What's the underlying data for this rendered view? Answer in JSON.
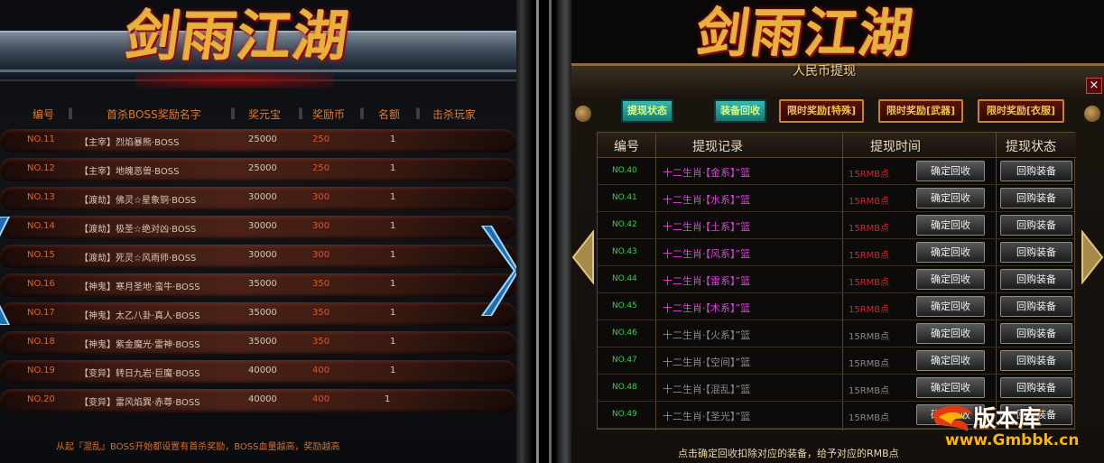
{
  "left_panel": {
    "logo_text": "剑雨江湖",
    "columns": [
      "编号",
      "首杀BOSS奖励名字",
      "奖元宝",
      "奖励币",
      "名额",
      "击杀玩家"
    ],
    "rows": [
      {
        "no": "NO.11",
        "name": "【主宰】烈焰暴熊·BOSS",
        "yuanbao": "25000",
        "coin": "250",
        "quota": "1"
      },
      {
        "no": "NO.12",
        "name": "【主宰】地魄恶兽·BOSS",
        "yuanbao": "25000",
        "coin": "250",
        "quota": "1"
      },
      {
        "no": "NO.13",
        "name": "【渡劫】佛灵☆星象铜·BOSS",
        "yuanbao": "30000",
        "coin": "300",
        "quota": "1"
      },
      {
        "no": "NO.14",
        "name": "【渡劫】极圣☆绝对凶·BOSS",
        "yuanbao": "30000",
        "coin": "300",
        "quota": "1"
      },
      {
        "no": "NO.15",
        "name": "【渡劫】死灵☆风雨师·BOSS",
        "yuanbao": "30000",
        "coin": "300",
        "quota": "1"
      },
      {
        "no": "NO.16",
        "name": "【神鬼】寒月圣地·蛮牛·BOSS",
        "yuanbao": "35000",
        "coin": "350",
        "quota": "1"
      },
      {
        "no": "NO.17",
        "name": "【神鬼】太乙八卦·真人·BOSS",
        "yuanbao": "35000",
        "coin": "350",
        "quota": "1"
      },
      {
        "no": "NO.18",
        "name": "【神鬼】紫金魔光·雷神·BOSS",
        "yuanbao": "35000",
        "coin": "350",
        "quota": "1"
      },
      {
        "no": "NO.19",
        "name": "【变异】转日九岩·巨魔·BOSS",
        "yuanbao": "40000",
        "coin": "400",
        "quota": "1"
      },
      {
        "no": "NO.20",
        "name": "【变异】雷风焰巽·赤尊·BOSS",
        "yuanbao": "40000",
        "coin": "400",
        "quota": "1"
      }
    ],
    "footer": "从起『混乱』BOSS开始都设置有首杀奖励，BOSS血量越高，奖励越高"
  },
  "right_panel": {
    "logo_text": "剑雨江湖",
    "subtitle": "人民币提现",
    "close_label": "×",
    "tabs": [
      "提现状态",
      "装备回收",
      "限时奖励[特殊]",
      "限时奖励[武器]",
      "限时奖励[衣服]"
    ],
    "columns": [
      "编号",
      "提现记录",
      "提现时间",
      "提现状态"
    ],
    "rows": [
      {
        "no": "NO.40",
        "record": "十二生肖·【金系】”篮",
        "time": "15RMB点",
        "active": true
      },
      {
        "no": "NO.41",
        "record": "十二生肖·【水系】”篮",
        "time": "15RMB点",
        "active": true
      },
      {
        "no": "NO.42",
        "record": "十二生肖·【土系】”篮",
        "time": "15RMB点",
        "active": true
      },
      {
        "no": "NO.43",
        "record": "十二生肖·【风系】”篮",
        "time": "15RMB点",
        "active": true
      },
      {
        "no": "NO.44",
        "record": "十二生肖·【雷系】”篮",
        "time": "15RMB点",
        "active": true
      },
      {
        "no": "NO.45",
        "record": "十二生肖·【木系】”篮",
        "time": "15RMB点",
        "active": true
      },
      {
        "no": "NO.46",
        "record": "十二生肖·【火系】”篮",
        "time": "15RMB点",
        "active": false
      },
      {
        "no": "NO.47",
        "record": "十二生肖·【空间】”篮",
        "time": "15RMB点",
        "active": false
      },
      {
        "no": "NO.48",
        "record": "十二生肖·【混乱】”篮",
        "time": "15RMB点",
        "active": false
      },
      {
        "no": "NO.49",
        "record": "十二生肖·【圣光】”篮",
        "time": "15RMB点",
        "active": false
      }
    ],
    "btn_confirm": "确定回收",
    "btn_buyback": "回购装备",
    "footer": "点击确定回收扣除对应的装备，给予对应的RMB点"
  },
  "watermark": {
    "text": "版本库",
    "url": "www.Gmbbk.cn"
  }
}
